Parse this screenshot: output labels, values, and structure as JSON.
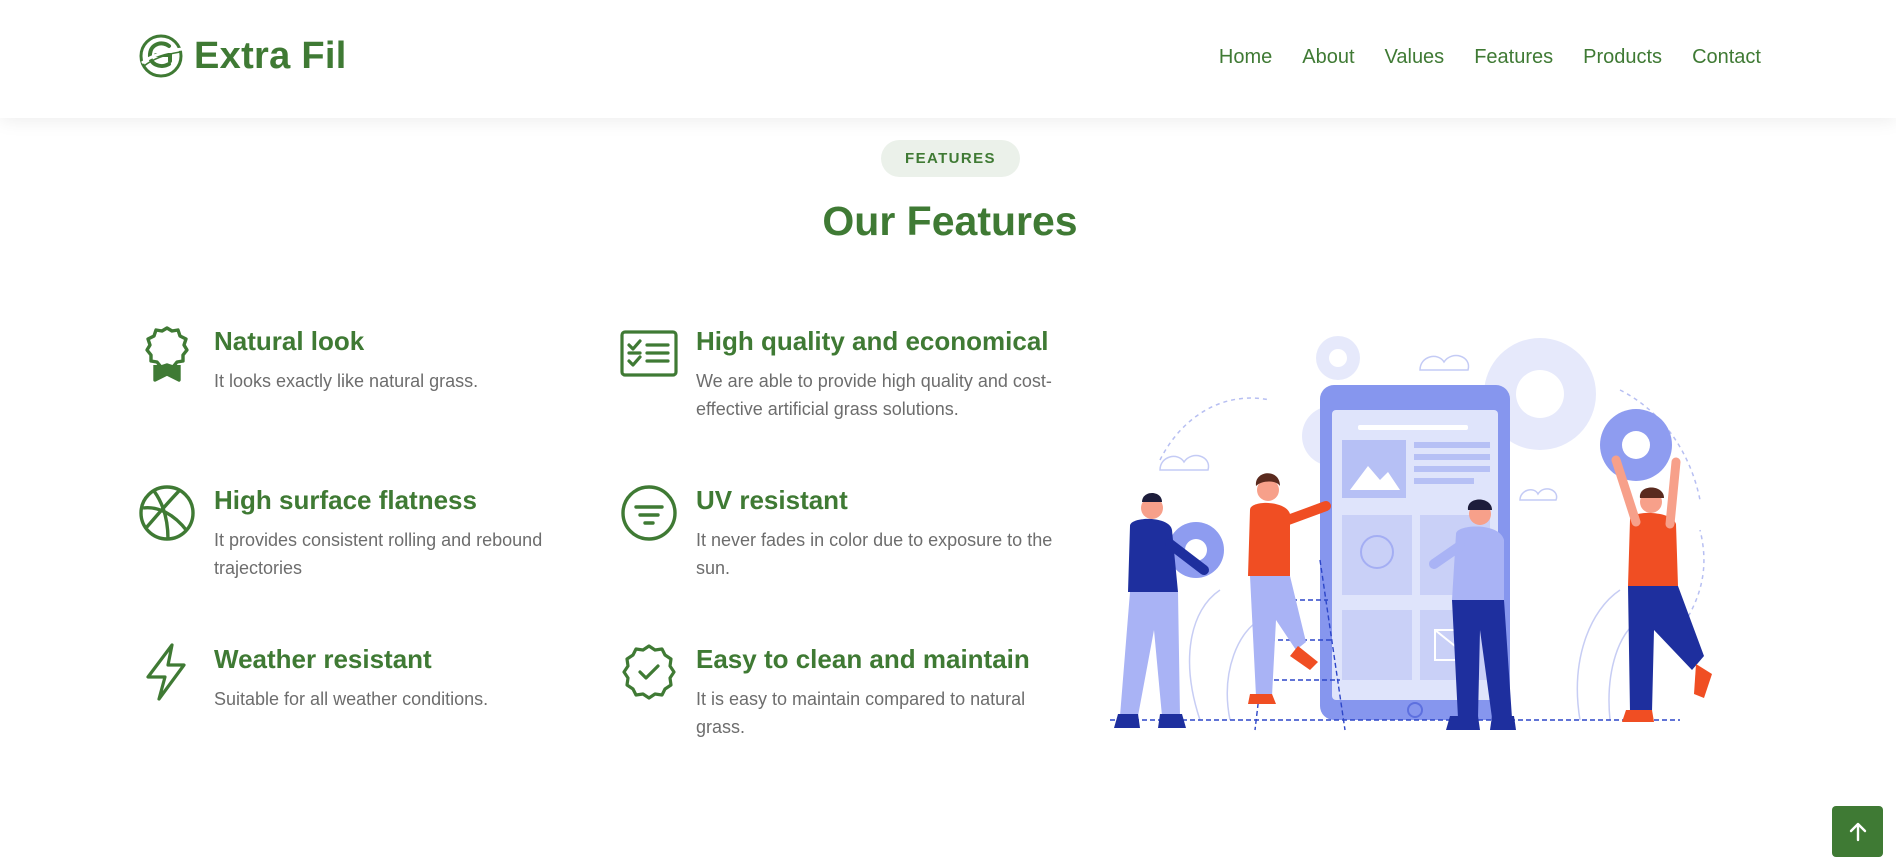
{
  "brand": {
    "name": "Extra Fil",
    "color": "#3f7a34"
  },
  "nav": {
    "items": [
      "Home",
      "About",
      "Values",
      "Features",
      "Products",
      "Contact"
    ]
  },
  "section": {
    "badge": "FEATURES",
    "title": "Our Features"
  },
  "features": [
    {
      "icon": "award-icon",
      "title": "Natural look",
      "desc": "It looks exactly like natural grass."
    },
    {
      "icon": "checklist-icon",
      "title": "High quality and economical",
      "desc": "We are able to provide high quality and cost-effective artificial grass solutions."
    },
    {
      "icon": "ball-icon",
      "title": "High surface flatness",
      "desc": "It provides consistent rolling and rebound trajectories"
    },
    {
      "icon": "filter-icon",
      "title": "UV resistant",
      "desc": "It never fades in color due to exposure to the sun."
    },
    {
      "icon": "lightning-icon",
      "title": "Weather resistant",
      "desc": "Suitable for all weather conditions."
    },
    {
      "icon": "badge-check-icon",
      "title": "Easy to clean and maintain",
      "desc": "It is easy to maintain compared to natural grass."
    }
  ],
  "back_to_top": {
    "icon": "arrow-up-icon"
  },
  "colors": {
    "accent": "#3f7a34",
    "text_muted": "#6d6d6d",
    "badge_bg": "#ebf1ea",
    "illustration_blue": "#8e9cf0",
    "illustration_orange": "#f04e23",
    "illustration_navy": "#1e2f9e"
  }
}
